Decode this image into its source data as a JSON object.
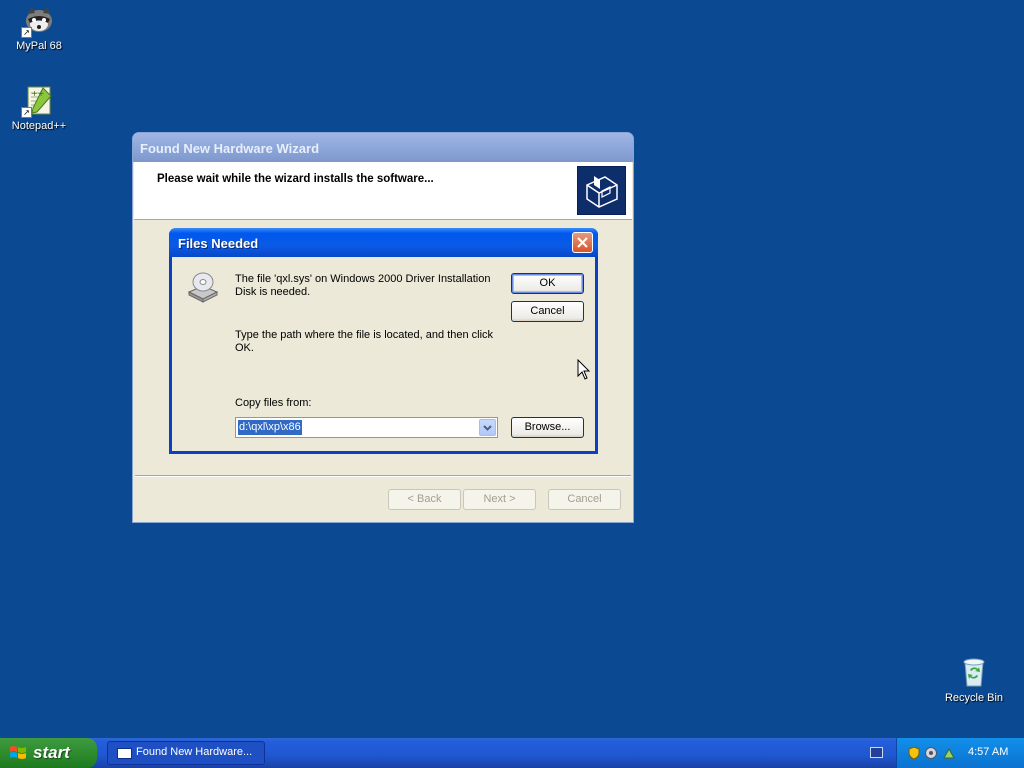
{
  "desktop": {
    "icons": [
      {
        "label": "MyPal 68",
        "icon": "mypal-raccoon-icon"
      },
      {
        "label": "Notepad++",
        "icon": "notepad-plus-plus-icon"
      },
      {
        "label": "Recycle Bin",
        "icon": "recycle-bin-icon"
      }
    ],
    "shortcut_arrow": "↗"
  },
  "wizard": {
    "title": "Found New Hardware Wizard",
    "header_text": "Please wait while the wizard installs the software...",
    "buttons": {
      "back": "< Back",
      "next": "Next >",
      "cancel": "Cancel"
    }
  },
  "files_needed": {
    "title": "Files Needed",
    "message_1": "The file 'qxl.sys' on Windows 2000 Driver Installation Disk is needed.",
    "message_2": "Type the path where the file is located, and then click OK.",
    "copy_label": "Copy files from:",
    "copy_value": "d:\\qxl\\xp\\x86",
    "ok": "OK",
    "cancel": "Cancel",
    "browse": "Browse..."
  },
  "taskbar": {
    "start_label": "start",
    "task_label": "Found New Hardware...",
    "clock": "4:57 AM"
  },
  "colors": {
    "desktop": "#0b4a92",
    "active_title": "#0058ee",
    "start_green": "#2f8c2f",
    "tray_blue": "#0f84e0"
  }
}
